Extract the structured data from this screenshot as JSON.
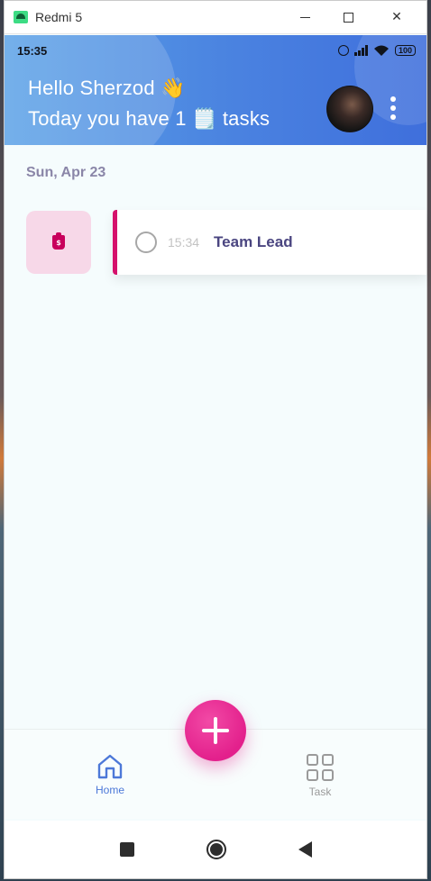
{
  "window": {
    "title": "Redmi 5",
    "minimize_icon": "minimize-icon",
    "maximize_icon": "maximize-icon",
    "close_icon": "close-icon",
    "close_glyph": "✕"
  },
  "status_bar": {
    "time": "15:35",
    "battery": "100",
    "icons": [
      "alarm-icon",
      "signal-icon",
      "wifi-icon",
      "battery-icon"
    ]
  },
  "header": {
    "greeting_line1": "Hello Sherzod 👋",
    "greeting_line2": "Today you have 1 🗒️ tasks",
    "avatar": "user-avatar",
    "menu_icon": "more-vertical-icon"
  },
  "main": {
    "date_label": "Sun, Apr 23",
    "tasks": [
      {
        "time": "15:34",
        "title": "Team Lead",
        "completed": false,
        "category_icon": "money-bag-icon",
        "category_color": "#f7d8e8",
        "accent_color": "#d5116c"
      }
    ]
  },
  "fab": {
    "icon": "plus-icon",
    "color": "#e3208c"
  },
  "bottom_nav": {
    "items": [
      {
        "label": "Home",
        "icon": "home-icon",
        "active": true
      },
      {
        "label": "Task",
        "icon": "grid-icon",
        "active": false
      }
    ],
    "active_color": "#4c78d8",
    "inactive_color": "#9a9a9a"
  },
  "system_nav": {
    "buttons": [
      "recents-icon",
      "home-circle-icon",
      "back-icon"
    ]
  }
}
